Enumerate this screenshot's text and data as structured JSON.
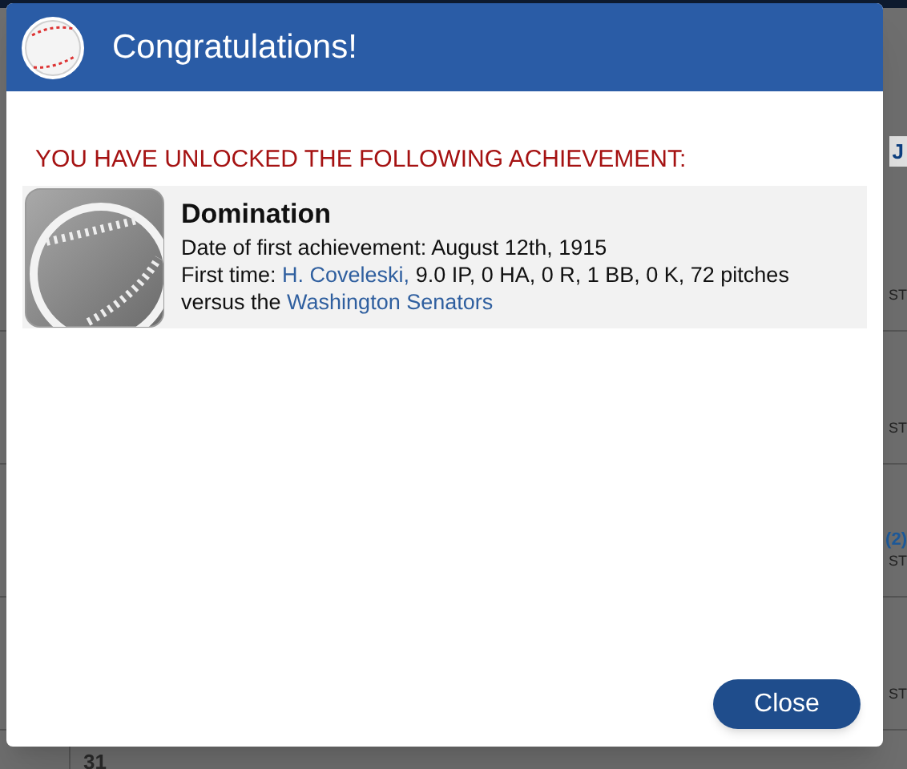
{
  "background": {
    "header_link": "J",
    "rows": [
      {
        "right_text": "ST"
      },
      {
        "right_text": "ST"
      },
      {
        "right_link": "(2)",
        "right_text": "ST"
      },
      {
        "right_text": "ST"
      },
      {
        "day": "31"
      }
    ]
  },
  "dialog": {
    "title": "Congratulations!",
    "heading": "YOU HAVE UNLOCKED THE FOLLOWING ACHIEVEMENT:",
    "achievement": {
      "name": "Domination",
      "date_line": "Date of first achievement: August 12th, 1915",
      "first_time": {
        "label": "First time:",
        "player": "H. Coveleski,",
        "stats": "9.0 IP, 0 HA, 0 R, 1 BB, 0 K, 72 pitches",
        "versus": "versus the",
        "team": "Washington Senators"
      }
    },
    "close_button": "Close"
  }
}
